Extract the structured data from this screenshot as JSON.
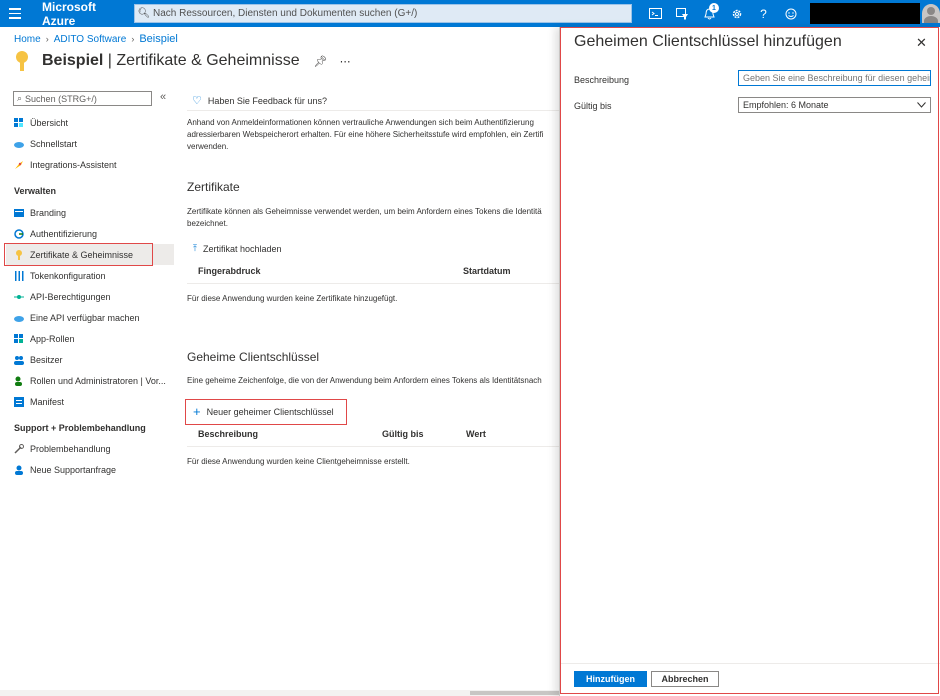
{
  "topbar": {
    "brand": "Microsoft Azure",
    "search_placeholder": "Nach Ressourcen, Diensten und Dokumenten suchen (G+/)",
    "notification_count": "1"
  },
  "breadcrumb": {
    "home": "Home",
    "org": "ADITO Software",
    "current": "Beispiel"
  },
  "header": {
    "title_bold": "Beispiel",
    "title_rest": " | Zertifikate & Geheimnisse"
  },
  "sidebar": {
    "search_placeholder": "Suchen (STRG+/)",
    "items_top": [
      {
        "label": "Übersicht"
      },
      {
        "label": "Schnellstart"
      },
      {
        "label": "Integrations-Assistent"
      }
    ],
    "group_manage": "Verwalten",
    "items_manage": [
      {
        "label": "Branding"
      },
      {
        "label": "Authentifizierung"
      },
      {
        "label": "Zertifikate & Geheimnisse"
      },
      {
        "label": "Tokenkonfiguration"
      },
      {
        "label": "API-Berechtigungen"
      },
      {
        "label": "Eine API verfügbar machen"
      },
      {
        "label": "App-Rollen"
      },
      {
        "label": "Besitzer"
      },
      {
        "label": "Rollen und Administratoren | Vor..."
      },
      {
        "label": "Manifest"
      }
    ],
    "group_support": "Support + Problembehandlung",
    "items_support": [
      {
        "label": "Problembehandlung"
      },
      {
        "label": "Neue Supportanfrage"
      }
    ]
  },
  "main": {
    "feedback": "Haben Sie Feedback für uns?",
    "intro_lines": [
      "Anhand von Anmeldeinformationen können vertrauliche Anwendungen sich beim Authentifizierung",
      "adressierbaren Webspeicherort erhalten. Für eine höhere Sicherheitsstufe wird empfohlen, ein Zertifi",
      "verwenden."
    ],
    "cert_title": "Zertifikate",
    "cert_lines": [
      "Zertifikate können als Geheimnisse verwendet werden, um beim Anfordern eines Tokens die Identitä",
      "bezeichnet."
    ],
    "cert_upload": "Zertifikat hochladen",
    "cert_col_thumbprint": "Fingerabdruck",
    "cert_col_start": "Startdatum",
    "cert_empty": "Für diese Anwendung wurden keine Zertifikate hinzugefügt.",
    "secret_title": "Geheime Clientschlüssel",
    "secret_line": "Eine geheime Zeichenfolge, die von der Anwendung beim Anfordern eines Tokens als Identitätsnach",
    "secret_new": "Neuer geheimer Clientschlüssel",
    "secret_col_desc": "Beschreibung",
    "secret_col_valid": "Gültig bis",
    "secret_col_value": "Wert",
    "secret_empty": "Für diese Anwendung wurden keine Clientgeheimnisse erstellt."
  },
  "panel": {
    "title": "Geheimen Clientschlüssel hinzufügen",
    "desc_label": "Beschreibung",
    "desc_placeholder": "Geben Sie eine Beschreibung für diesen geheime",
    "valid_label": "Gültig bis",
    "valid_value": "Empfohlen: 6 Monate",
    "add_button": "Hinzufügen",
    "cancel_button": "Abbrechen"
  },
  "colors": {
    "accent": "#0078d4",
    "highlight_border": "#e04848"
  }
}
